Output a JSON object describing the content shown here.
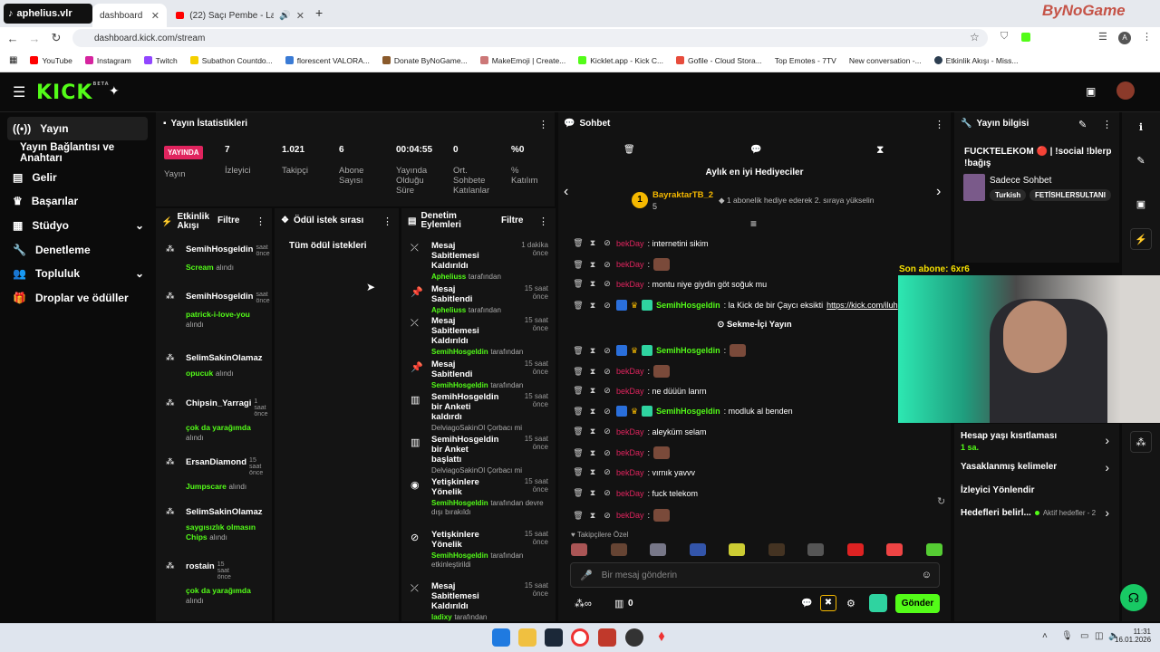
{
  "browser": {
    "tabs": [
      "aphelius.vlr",
      "dashboard",
      "(22) Saçı Pembe - Lanetkel"
    ],
    "url": "dashboard.kick.com/stream",
    "bookmarks": [
      "YouTube",
      "Instagram",
      "Twitch",
      "Subathon Countdo...",
      "florescent VALORA...",
      "Donate ByNoGame...",
      "MakeEmoji | Create...",
      "Kicklet.app - Kick C...",
      "Gofile - Cloud Stora...",
      "Top Emotes - 7TV",
      "New conversation -...",
      "Etkinlik Akışı - Miss..."
    ],
    "watermark": "ByNoGame"
  },
  "kick": {
    "logo": "KICK",
    "beta": "BETA"
  },
  "nav": [
    {
      "label": "Yayın",
      "icon": "broadcast-icon"
    },
    {
      "label": "Yayın Bağlantısı ve Anahtarı",
      "icon": ""
    },
    {
      "label": "Gelir",
      "icon": "dollar-icon"
    },
    {
      "label": "Başarılar",
      "icon": "trophy-icon"
    },
    {
      "label": "Stüdyo",
      "icon": "studio-icon"
    },
    {
      "label": "Denetleme",
      "icon": "wrench-icon"
    },
    {
      "label": "Topluluk",
      "icon": "people-icon"
    },
    {
      "label": "Droplar ve ödüller",
      "icon": "gift-icon"
    }
  ],
  "stats": {
    "title": "Yayın İstatistikleri",
    "live": "YAYINDA",
    "items": [
      {
        "value": "",
        "label": "Yayın"
      },
      {
        "value": "7",
        "label": "İzleyici"
      },
      {
        "value": "1.021",
        "label": "Takipçi"
      },
      {
        "value": "6",
        "label": "Abone Sayısı"
      },
      {
        "value": "00:04:55",
        "label": "Yayında Olduğu Süre"
      },
      {
        "value": "0",
        "label": "Ort. Sohbete Katılanlar"
      },
      {
        "value": "%0",
        "label": "% Katılım"
      }
    ]
  },
  "activity": {
    "title": "Etkinlik Akışı",
    "filter": "Filtre",
    "items": [
      {
        "name": "SemihHosgeldin",
        "time": "saat önce",
        "reward": "Scream",
        "suffix": "alındı"
      },
      {
        "name": "SemihHosgeldin",
        "time": "saat önce",
        "reward": "patrick-i-love-you",
        "suffix": "alındı"
      },
      {
        "name": "SelimSakinOlamaz",
        "time": "",
        "reward": "opucuk",
        "suffix": "alındı"
      },
      {
        "name": "Chipsin_Yarragi",
        "time": "1 saat önce",
        "reward": "çok da yarağımda",
        "suffix": "alındı"
      },
      {
        "name": "ErsanDiamond",
        "time": "15 saat önce",
        "reward": "Jumpscare",
        "suffix": "alındı"
      },
      {
        "name": "SelimSakinOlamaz",
        "time": "",
        "reward": "saygısızlık olmasın Chips",
        "suffix": "alındı"
      },
      {
        "name": "rostain",
        "time": "15 saat önce",
        "reward": "çok da yarağımda",
        "suffix": "alındı"
      }
    ]
  },
  "rewards": {
    "title": "Ödül istek sırası",
    "all": "Tüm ödül istekleri"
  },
  "modlog": {
    "title": "Denetim Eylemleri",
    "filter": "Filtre",
    "items": [
      {
        "action": "Mesaj Sabitlemesi Kaldırıldı",
        "time": "1 dakika önce",
        "by": "Apheliuss",
        "suffix": "tarafından",
        "icon": "unpin-icon"
      },
      {
        "action": "Mesaj Sabitlendi",
        "time": "15 saat önce",
        "by": "Apheliuss",
        "suffix": "tarafından",
        "icon": "pin-icon"
      },
      {
        "action": "Mesaj Sabitlemesi Kaldırıldı",
        "time": "15 saat önce",
        "by": "SemihHosgeldin",
        "suffix": "tarafından",
        "icon": "unpin-icon"
      },
      {
        "action": "Mesaj Sabitlendi",
        "time": "15 saat önce",
        "by": "SemihHosgeldin",
        "suffix": "tarafından",
        "icon": "pin-icon"
      },
      {
        "action": "SemihHosgeldin bir Anketi kaldırdı",
        "time": "15 saat önce",
        "by": "DelviagoSakinOl Çorbacı mi",
        "suffix": "",
        "icon": "poll-icon"
      },
      {
        "action": "SemihHosgeldin bir Anket başlattı",
        "time": "15 saat önce",
        "by": "DelviagoSakinOl Çorbacı mi",
        "suffix": "",
        "icon": "poll-icon"
      },
      {
        "action": "Yetişkinlere Yönelik",
        "time": "15 saat önce",
        "by": "SemihHosgeldin",
        "suffix": "tarafından devre dışı bırakıldı",
        "icon": "eye-icon"
      },
      {
        "action": "Yetişkinlere Yönelik",
        "time": "15 saat önce",
        "by": "SemihHosgeldin",
        "suffix": "tarafından etkinleştirildi",
        "icon": "eye-off-icon"
      },
      {
        "action": "Mesaj Sabitlemesi Kaldırıldı",
        "time": "15 saat önce",
        "by": "ladixy",
        "suffix": "tarafından",
        "icon": "unpin-icon"
      }
    ]
  },
  "chat": {
    "title": "Sohbet",
    "gifters_title": "Aylık en iyi Hediyeciler",
    "top_gifter": {
      "rank": "1",
      "name": "BayraktarTB_2",
      "count": "5",
      "text": "1 abonelik hediye ederek 2. sıraya yükselin"
    },
    "messages": [
      {
        "user": "bekDay",
        "text": ": internetini sikim",
        "emote": false
      },
      {
        "user": "bekDay",
        "text": ":",
        "emote": true
      },
      {
        "user": "bekDay",
        "text": ": montu niye giydin göt soğuk mu",
        "emote": false
      },
      {
        "user": "SemihHosgeldin",
        "text": ": la Kick de bir Çaycı eksikti",
        "link": "https://kick.com/iluh",
        "emote": false
      },
      {
        "user": "SemihHosgeldin",
        "text": ":",
        "emote": true
      },
      {
        "user": "bekDay",
        "text": ":",
        "emote": true
      },
      {
        "user": "bekDay",
        "text": ": ne düüün lanrn",
        "emote": false
      },
      {
        "user": "SemihHosgeldin",
        "text": ": modluk al benden",
        "emote": false
      },
      {
        "user": "bekDay",
        "text": ": aleyküm selam",
        "emote": false
      },
      {
        "user": "bekDay",
        "text": ":",
        "emote": true
      },
      {
        "user": "bekDay",
        "text": ": vırnık yavvv",
        "emote": false
      },
      {
        "user": "bekDay",
        "text": ": fuck telekom",
        "emote": false
      },
      {
        "user": "bekDay",
        "text": ":",
        "emote": true
      }
    ],
    "divider": "Sekme-İçi Yayın",
    "followers_only": "Takipçilere Özel",
    "placeholder": "Bir mesaj gönderin",
    "count": "0",
    "send": "Gönder"
  },
  "info": {
    "title": "Yayın bilgisi",
    "stream_title": "FUCKTELEKOM 🔴 | !social !blerp !bağış",
    "category": "Sadece Sohbet",
    "tags": [
      "Turkish",
      "FETİSHLERSULTANI"
    ],
    "overlay_label": "Son abone: 6xr6",
    "settings": [
      {
        "label": "Hesap yaşı kısıtlaması",
        "value": "1 sa."
      },
      {
        "label": "Yasaklanmış kelimeler",
        "value": ""
      },
      {
        "label": "İzleyici Yönlendir",
        "value": ""
      },
      {
        "label": "Hedefleri belirl...",
        "value": "Aktif hedefler - 2"
      }
    ]
  },
  "taskbar": {
    "time": "11:31",
    "date": "16.01.2026"
  },
  "colors": {
    "accent": "#53fc18",
    "live": "#e0245e",
    "panel": "#141414"
  }
}
